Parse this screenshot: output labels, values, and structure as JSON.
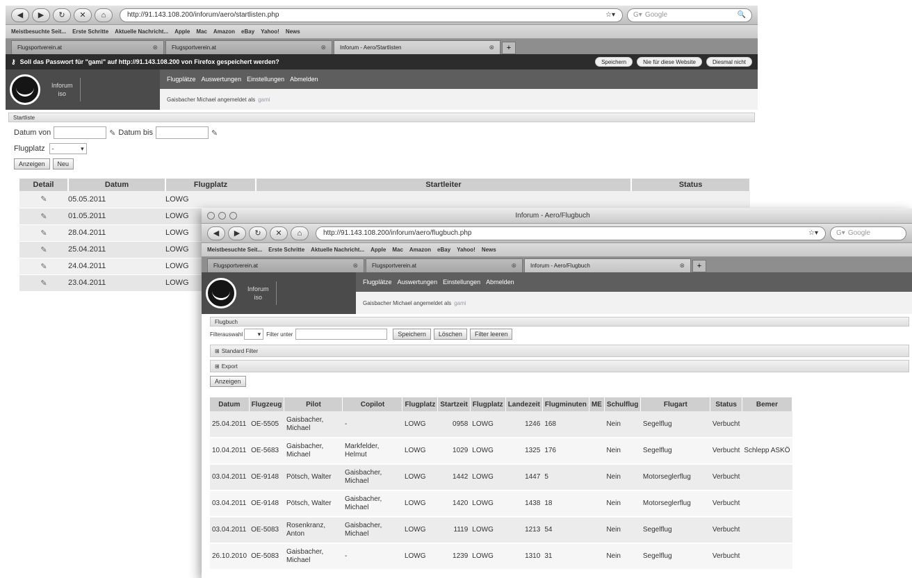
{
  "win1": {
    "toolbar": {
      "url": "http://91.143.108.200/inforum/aero/startlisten.php",
      "search_placeholder": "Google"
    },
    "bookmarks": [
      "Meistbesuchte Seit...",
      "Erste Schritte",
      "Aktuelle Nachricht...",
      "Apple",
      "Mac",
      "Amazon",
      "eBay",
      "Yahoo!",
      "News"
    ],
    "tabs": [
      {
        "label": "Flugsportverein.at"
      },
      {
        "label": "Flugsportverein.at"
      },
      {
        "label": "Inforum - Aero/Startlisten"
      }
    ],
    "password_bar": {
      "message": "Soll das Passwort für \"gami\" auf http://91.143.108.200 von Firefox gespeichert werden?",
      "save": "Speichern",
      "never": "Nie für diese Website",
      "not_now": "Diesmal nicht"
    },
    "app": {
      "brand_line1": "Inforum",
      "brand_line2": "iso",
      "menu": [
        "Flugplätze",
        "Auswertungen",
        "Einstellungen",
        "Abmelden"
      ],
      "user_text": "Gaisbacher Michael angemeldet als",
      "user_link": "gami"
    },
    "section_title": "Startliste",
    "form": {
      "date_from_label": "Datum von",
      "date_to_label": "Datum bis",
      "airfield_label": "Flugplatz",
      "airfield_value": "-",
      "show_button": "Anzeigen",
      "new_button": "Neu"
    },
    "table": {
      "headers": [
        "Detail",
        "Datum",
        "Flugplatz",
        "Startleiter",
        "Status"
      ],
      "rows": [
        {
          "date": "05.05.2011",
          "airfield": "LOWG",
          "leader": "",
          "status": ""
        },
        {
          "date": "01.05.2011",
          "airfield": "LOWG",
          "leader": "",
          "status": ""
        },
        {
          "date": "28.04.2011",
          "airfield": "LOWG",
          "leader": "",
          "status": ""
        },
        {
          "date": "25.04.2011",
          "airfield": "LOWG",
          "leader": "",
          "status": ""
        },
        {
          "date": "24.04.2011",
          "airfield": "LOWG",
          "leader": "",
          "status": ""
        },
        {
          "date": "23.04.2011",
          "airfield": "LOWG",
          "leader": "",
          "status": ""
        }
      ]
    }
  },
  "win2": {
    "window_title": "Inforum - Aero/Flugbuch",
    "toolbar": {
      "url": "http://91.143.108.200/inforum/aero/flugbuch.php",
      "search_placeholder": "Google"
    },
    "bookmarks": [
      "Meistbesuchte Seit...",
      "Erste Schritte",
      "Aktuelle Nachricht...",
      "Apple",
      "Mac",
      "Amazon",
      "eBay",
      "Yahoo!",
      "News"
    ],
    "tabs": [
      {
        "label": "Flugsportverein.at"
      },
      {
        "label": "Flugsportverein.at"
      },
      {
        "label": "Inforum - Aero/Flugbuch"
      }
    ],
    "app": {
      "brand_line1": "Inforum",
      "brand_line2": "iso",
      "menu": [
        "Flugplätze",
        "Auswertungen",
        "Einstellungen",
        "Abmelden"
      ],
      "user_text": "Gaisbacher Michael angemeldet als",
      "user_link": "gami"
    },
    "section_title": "Flugbuch",
    "filter": {
      "selection_label": "Filterauswahl",
      "name_label": "Filter unter",
      "save_button": "Speichern",
      "delete_button": "Löschen",
      "clear_button": "Filter leeren"
    },
    "standard_filter": "Standard Filter",
    "export": "Export",
    "show_button": "Anzeigen",
    "table": {
      "headers": [
        "Datum",
        "Flugzeug",
        "Pilot",
        "Copilot",
        "Flugplatz",
        "Startzeit",
        "Flugplatz",
        "Landezeit",
        "Flugminuten",
        "ME",
        "Schulflug",
        "Flugart",
        "Status",
        "Bemer"
      ],
      "rows": [
        {
          "date": "25.04.2011",
          "plane": "OE-5505",
          "pilot": "Gaisbacher, Michael",
          "copilot": "-",
          "from": "LOWG",
          "start": "0958",
          "to": "LOWG",
          "land": "1246",
          "minutes": "168",
          "me": "",
          "school": "Nein",
          "type": "Segelflug",
          "status": "Verbucht",
          "note": ""
        },
        {
          "date": "10.04.2011",
          "plane": "OE-5683",
          "pilot": "Gaisbacher, Michael",
          "copilot": "Markfelder, Helmut",
          "from": "LOWG",
          "start": "1029",
          "to": "LOWG",
          "land": "1325",
          "minutes": "176",
          "me": "",
          "school": "Nein",
          "type": "Segelflug",
          "status": "Verbucht",
          "note": "Schlepp ASKÖ"
        },
        {
          "date": "03.04.2011",
          "plane": "OE-9148",
          "pilot": "Pötsch, Walter",
          "copilot": "Gaisbacher, Michael",
          "from": "LOWG",
          "start": "1442",
          "to": "LOWG",
          "land": "1447",
          "minutes": "5",
          "me": "",
          "school": "Nein",
          "type": "Motorseglerflug",
          "status": "Verbucht",
          "note": ""
        },
        {
          "date": "03.04.2011",
          "plane": "OE-9148",
          "pilot": "Pötsch, Walter",
          "copilot": "Gaisbacher, Michael",
          "from": "LOWG",
          "start": "1420",
          "to": "LOWG",
          "land": "1438",
          "minutes": "18",
          "me": "",
          "school": "Nein",
          "type": "Motorseglerflug",
          "status": "Verbucht",
          "note": ""
        },
        {
          "date": "03.04.2011",
          "plane": "OE-5083",
          "pilot": "Rosenkranz, Anton",
          "copilot": "Gaisbacher, Michael",
          "from": "LOWG",
          "start": "1119",
          "to": "LOWG",
          "land": "1213",
          "minutes": "54",
          "me": "",
          "school": "Nein",
          "type": "Segelflug",
          "status": "Verbucht",
          "note": ""
        },
        {
          "date": "26.10.2010",
          "plane": "OE-5083",
          "pilot": "Gaisbacher, Michael",
          "copilot": "-",
          "from": "LOWG",
          "start": "1239",
          "to": "LOWG",
          "land": "1310",
          "minutes": "31",
          "me": "",
          "school": "Nein",
          "type": "Segelflug",
          "status": "Verbucht",
          "note": ""
        }
      ]
    }
  }
}
